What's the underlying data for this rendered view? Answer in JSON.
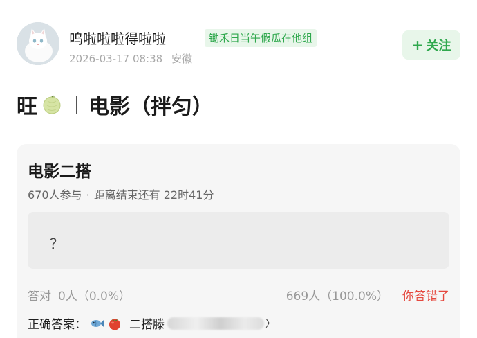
{
  "user": {
    "name": "呜啦啦啦得啦啦",
    "group_tag": "锄禾日当午假瓜在他组",
    "datetime": "2026-03-17 08:38",
    "location": "安徽"
  },
  "follow": {
    "label": "关注",
    "plus": "+"
  },
  "post": {
    "title_prefix": "旺",
    "title_main": "电影（拌匀）"
  },
  "poll": {
    "title": "电影二搭",
    "participants": "670人参与",
    "dot": "·",
    "remaining": "距离结束还有 22时41分",
    "option_label": "？",
    "correct_label": "答对",
    "correct_count": "0人（0.0%）",
    "wrong_count": "669人（100.0%）",
    "wrong_status": "你答错了",
    "answer_label": "正确答案：",
    "answer_text": "二搭滕",
    "answer_arrow": "〉"
  },
  "colors": {
    "green_accent": "#2fa84d",
    "green_bg": "#e8f6ea",
    "red": "#e5483e"
  },
  "icons": {
    "avatar": "white-cat-avatar",
    "title_emoji": "melon-icon",
    "answer_emoji_1": "fish-icon",
    "answer_emoji_2": "tomato-icon"
  }
}
